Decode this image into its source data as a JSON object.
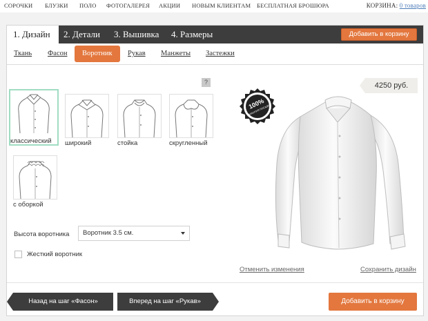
{
  "topnav": {
    "items": [
      "СОРОЧКИ",
      "БЛУЗКИ",
      "ПОЛО",
      "ФОТОГАЛЕРЕЯ",
      "АКЦИИ",
      "НОВЫМ КЛИЕНТАМ",
      "БЕСПЛАТНАЯ БРОШЮРА"
    ],
    "cart_label": "КОРЗИНА:",
    "cart_link": "0 товаров"
  },
  "steps": [
    "1. Дизайн",
    "2. Детали",
    "3. Вышивка",
    "4. Размеры"
  ],
  "header_cart_button": "Добавить в корзину",
  "subtabs": [
    "Ткань",
    "Фасон",
    "Воротник",
    "Рукав",
    "Манжеты",
    "Застежки"
  ],
  "help": "?",
  "collar_options": [
    "классический",
    "широкий",
    "стойка",
    "скругленный",
    "с оборкой"
  ],
  "collar_height": {
    "label": "Высота воротника",
    "value": "Воротник 3.5 см."
  },
  "rigid_collar": {
    "label": "Жесткий воротник",
    "checked": false
  },
  "price": "4250 руб.",
  "badge": {
    "top": "100%",
    "bottom": "ГАРАНТИЯ ПОСАДКИ"
  },
  "links": {
    "cancel": "Отменить изменения",
    "save": "Сохранить дизайн"
  },
  "footer": {
    "back": "Назад на шаг «Фасон»",
    "forward": "Вперед на шаг «Рукав»",
    "add": "Добавить в корзину"
  },
  "colors": {
    "accent": "#e3773e",
    "dark": "#3d3d3d",
    "selected": "#9fdcc2"
  }
}
